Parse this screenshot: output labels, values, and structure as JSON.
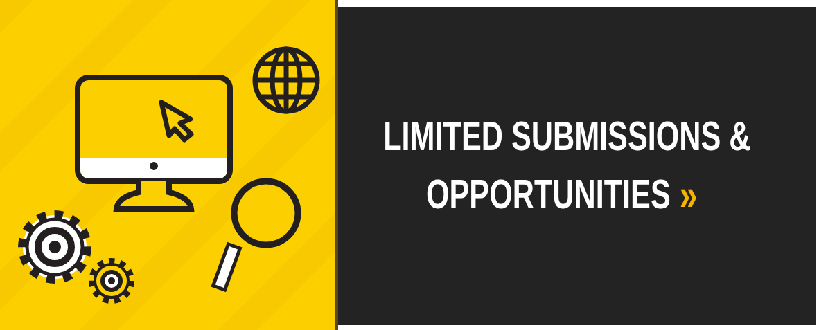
{
  "banner": {
    "title_lines": [
      "LIMITED SUBMISSIONS &",
      "OPPORTUNITIES"
    ],
    "arrow": "»"
  }
}
